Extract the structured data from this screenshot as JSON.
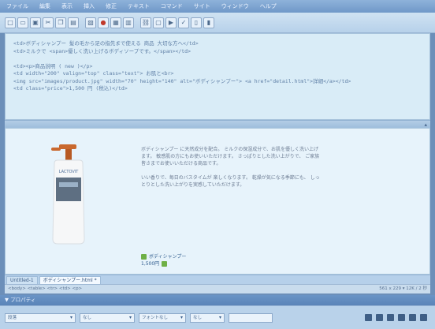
{
  "menubar": {
    "items": [
      "ファイル",
      "編集",
      "表示",
      "挿入",
      "修正",
      "テキスト",
      "コマンド",
      "サイト",
      "ウィンドウ",
      "ヘルプ"
    ]
  },
  "toolbar": {
    "icons": [
      "new-icon",
      "open-icon",
      "save-icon",
      "cut-icon",
      "copy-icon",
      "paste-icon",
      "image-icon",
      "record-icon",
      "table-icon",
      "layer-icon",
      "link-icon",
      "frame-icon",
      "preview-icon",
      "check-icon",
      "code-view-icon",
      "design-view-icon"
    ]
  },
  "code_view": {
    "lines": [
      "<td>ボディシャンプー 髪の毛から足の指先まで使える 商品 大切な方へ</td>",
      "<td>ミルクで <span>優しく洗い上げるボディソープです。</span></td>",
      "",
      "<td><p>商品説明 ( new )</p>",
      "<td width=\"200\" valign=\"top\" class=\"text\"> お肌と<br>",
      "<img src=\"images/product.jpg\" width=\"70\" height=\"140\" alt=\"ボディシャンプー\"> <a href=\"detail.html\">詳細</a></td>",
      "<td class=\"price\">1,500 円 (税込)</td>"
    ]
  },
  "design_view": {
    "paragraphs": [
      "ボディシャンプー に天然成分を配合。 ミルクの保湿成分で、お肌を優しく洗い上げます。 敏感肌の方にもお使いいただけます。 さっぱりとした洗い上がりで、 ご家族皆さまでお使いいただける商品です。",
      "いい香りで、毎日のバスタイムが 楽しくなります。 乾燥が気になる季節にも、 しっとりとした洗い上がりを実感していただけます。"
    ],
    "brand": "ボディシャンプー",
    "price": "1,500円",
    "bottle_brand_label": "LACTOVIT"
  },
  "tabs": [
    {
      "label": "Untitled-1",
      "active": false
    },
    {
      "label": "ボディシャンプー.html *",
      "active": true
    }
  ],
  "status": {
    "left": "<body> <table> <tr> <td> <p>",
    "right": "561 x 229 ▾ 12K / 2 秒"
  },
  "properties": {
    "title": "▼ プロパティ",
    "format_value": "段落",
    "style_value": "なし",
    "font_value": "フォントなし",
    "size_value": "なし"
  },
  "colors": {
    "accent": "#6c8fb9",
    "code_bg": "#d9ecf7",
    "design_bg": "#e7f3fb",
    "pump_orange": "#c9682e"
  }
}
